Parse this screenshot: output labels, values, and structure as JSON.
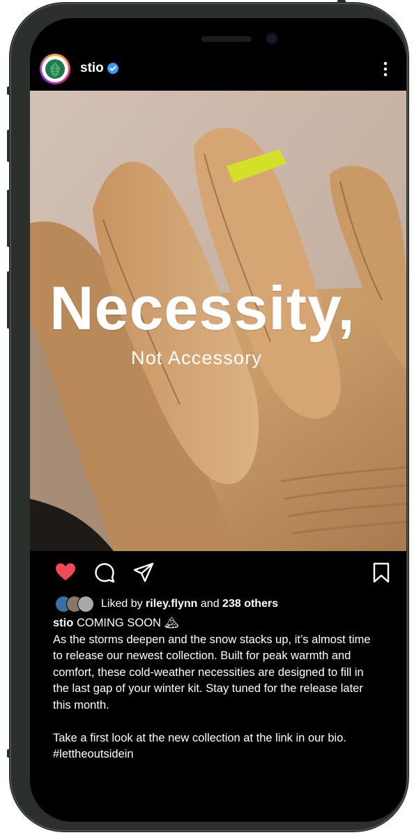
{
  "post": {
    "username": "stio",
    "image": {
      "headline": "Necessity,",
      "subline": "Not Accessory"
    },
    "likes": {
      "prefix": "Liked by",
      "user": "riley.flynn",
      "and": "and",
      "others": "238 others"
    },
    "caption": {
      "username": "stio",
      "title": "COMING SOON",
      "title_emoji": "🏔",
      "lines": [
        "As the storms deepen and the snow stacks up, it’s almost time",
        "to release our newest collection. Built for peak warmth and",
        "comfort, these cold-weather necessities are designed to fill in",
        "the last gap of your winter kit. Stay tuned for the release later",
        "this month."
      ],
      "closing": "Take a first look at the new collection at the link in our bio.",
      "hashtag": "#lettheoutsidein"
    }
  },
  "colors": {
    "like_red": "#ed4956",
    "verified_blue": "#3897f0",
    "accent_yellow": "#d4df2a",
    "glove_tan": "#c89a68"
  }
}
